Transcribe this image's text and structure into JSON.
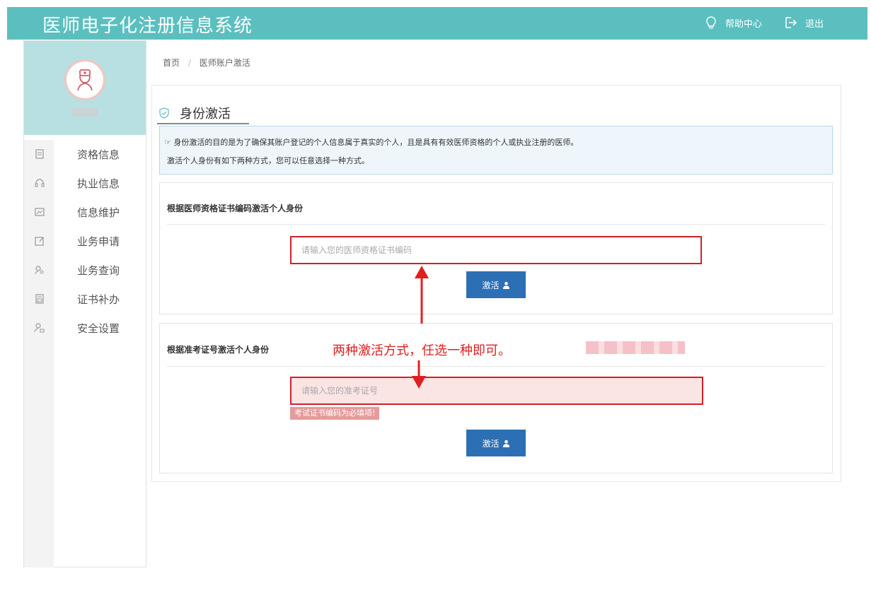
{
  "header": {
    "title": "医师电子化注册信息系统",
    "help_label": "帮助中心",
    "logout_label": "退出",
    "bg_color": "#5bbfbf"
  },
  "sidebar": {
    "items": [
      {
        "label": "资格信息",
        "icon": "document-icon"
      },
      {
        "label": "执业信息",
        "icon": "headset-icon"
      },
      {
        "label": "信息维护",
        "icon": "image-icon"
      },
      {
        "label": "业务申请",
        "icon": "edit-icon"
      },
      {
        "label": "业务查询",
        "icon": "search-user-icon"
      },
      {
        "label": "证书补办",
        "icon": "certificate-icon"
      },
      {
        "label": "安全设置",
        "icon": "user-lock-icon"
      }
    ]
  },
  "breadcrumb": {
    "home": "首页",
    "separator": "/",
    "current": "医师账户激活"
  },
  "section": {
    "title": "身份激活"
  },
  "notice": {
    "line1": "身份激活的目的是为了确保其账户登记的个人信息属于真实的个人，且是具有有效医师资格的个人或执业注册的医师。",
    "line2": "激活个人身份有如下两种方式，您可以任意选择一种方式。"
  },
  "method1": {
    "title": "根据医师资格证书编码激活个人身份",
    "placeholder": "请输入您的医师资格证书编码",
    "button_label": "激活"
  },
  "method2": {
    "title": "根据准考证号激活个人身份",
    "placeholder": "请输入您的准考证号",
    "error_text": "考试证书编码为必填项!",
    "button_label": "激活"
  },
  "annotation": {
    "text": "两种激活方式，任选一种即可。",
    "color": "#e02020"
  }
}
